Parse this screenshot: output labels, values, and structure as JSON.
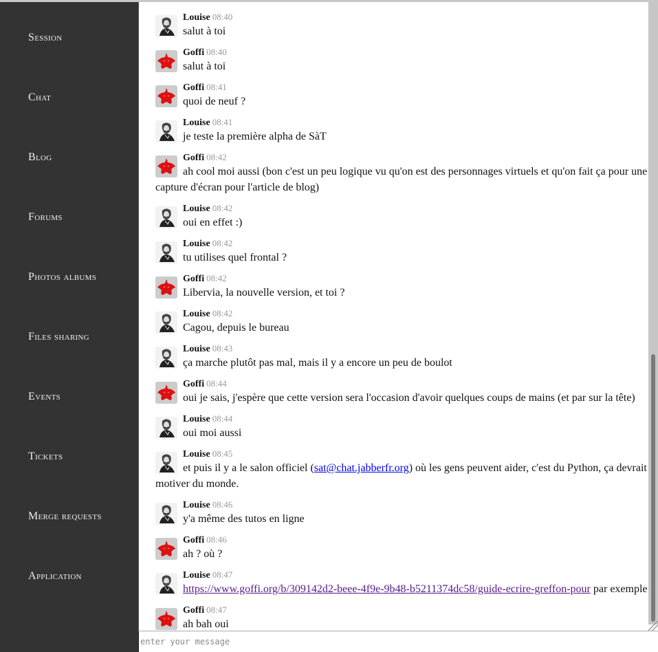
{
  "sidebar": {
    "items": [
      {
        "label": "Session"
      },
      {
        "label": "Chat"
      },
      {
        "label": "Blog"
      },
      {
        "label": "Forums"
      },
      {
        "label": "Photos albums"
      },
      {
        "label": "Files sharing"
      },
      {
        "label": "Events"
      },
      {
        "label": "Tickets"
      },
      {
        "label": "Merge requests"
      },
      {
        "label": "Application"
      }
    ]
  },
  "chat": {
    "messages": [
      {
        "author": "Louise",
        "avatar": "louise-avatar",
        "time": "08:40",
        "text": "salut à toi"
      },
      {
        "author": "Goffi",
        "avatar": "goffi-avatar",
        "time": "08:40",
        "text": "salut à toi"
      },
      {
        "author": "Goffi",
        "avatar": "goffi-avatar",
        "time": "08:41",
        "text": "quoi de neuf ?"
      },
      {
        "author": "Louise",
        "avatar": "louise-avatar",
        "time": "08:41",
        "text": "je teste la première alpha de SàT"
      },
      {
        "author": "Goffi",
        "avatar": "goffi-avatar",
        "time": "08:42",
        "text": "ah cool moi aussi (bon c'est un peu logique vu qu'on est des personnages virtuels et qu'on fait ça pour une capture d'écran pour l'article de blog)"
      },
      {
        "author": "Louise",
        "avatar": "louise-avatar",
        "time": "08:42",
        "text": "oui en effet :)"
      },
      {
        "author": "Louise",
        "avatar": "louise-avatar",
        "time": "08:42",
        "text": "tu utilises quel frontal ?"
      },
      {
        "author": "Goffi",
        "avatar": "goffi-avatar",
        "time": "08:42",
        "text": "Libervia, la nouvelle version, et toi ?"
      },
      {
        "author": "Louise",
        "avatar": "louise-avatar",
        "time": "08:42",
        "text": "Cagou, depuis le bureau"
      },
      {
        "author": "Louise",
        "avatar": "louise-avatar",
        "time": "08:43",
        "text": "ça marche plutôt pas mal, mais il y a encore un peu de boulot"
      },
      {
        "author": "Goffi",
        "avatar": "goffi-avatar",
        "time": "08:44",
        "text": "oui je sais, j'espère que cette version sera l'occasion d'avoir quelques coups de mains (et par sur la tête)"
      },
      {
        "author": "Louise",
        "avatar": "louise-avatar",
        "time": "08:44",
        "text": "oui moi aussi"
      },
      {
        "author": "Louise",
        "avatar": "louise-avatar",
        "time": "08:45",
        "text_before": "et puis il y a le salon officiel (",
        "link": "sat@chat.jabberfr.org",
        "text_after": ") où les gens peuvent aider, c'est du Python, ça devrait motiver du monde."
      },
      {
        "author": "Louise",
        "avatar": "louise-avatar",
        "time": "08:46",
        "text": "y'a même des tutos en ligne"
      },
      {
        "author": "Goffi",
        "avatar": "goffi-avatar",
        "time": "08:46",
        "text": "ah ? où ?"
      },
      {
        "author": "Louise",
        "avatar": "louise-avatar",
        "time": "08:47",
        "text_before": "",
        "link": "https://www.goffi.org/b/309142d2-beee-4f9e-9b48-b5211374dc58/guide-ecrire-greffon-pour",
        "text_after": " par exemple"
      },
      {
        "author": "Goffi",
        "avatar": "goffi-avatar",
        "time": "08:47",
        "text": "ah bah oui"
      }
    ]
  },
  "composer": {
    "placeholder": "enter your message",
    "value": ""
  },
  "scroll": {
    "position_fraction": 0.57,
    "visible_fraction": 0.43
  },
  "colors": {
    "sidebar_bg": "#333333",
    "sidebar_text": "#f0f0f0",
    "link": "#0000ee",
    "visited_link": "#551a8b",
    "goffi_avatar": "#dd1111"
  }
}
